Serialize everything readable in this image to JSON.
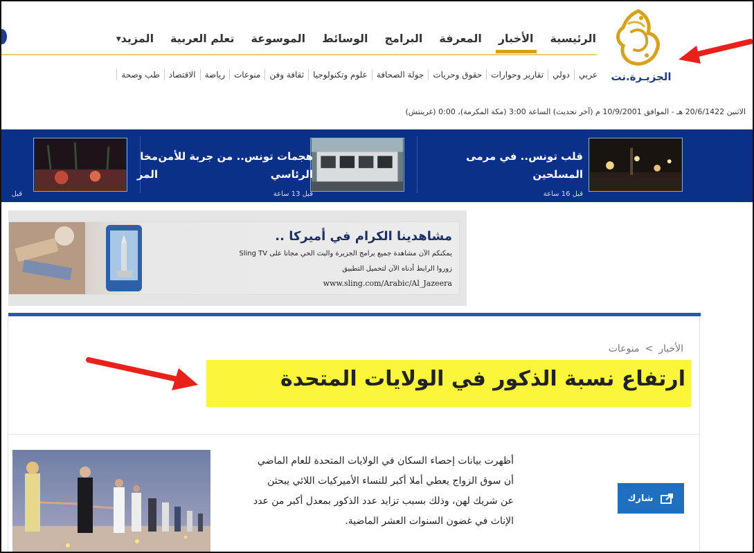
{
  "nav": {
    "main": [
      "الرئيسية",
      "الأخبار",
      "المعرفة",
      "البرامج",
      "الوسائط",
      "الموسوعة",
      "تعلم العربية",
      "المزيد"
    ],
    "active_index": 1,
    "sub": [
      "عربي",
      "دولي",
      "تقارير وحوارات",
      "حقوق وحريات",
      "جولة الصحافة",
      "علوم وتكنولوجيا",
      "ثقافة وفن",
      "منوعات",
      "رياضة",
      "الاقتصاد",
      "طب وصحة"
    ]
  },
  "brand": {
    "name": "الجزيـرة.نت",
    "accent": "#d7a21b",
    "blue": "#0a3088"
  },
  "dateline": "الاثنين 20/6/1422 هـ - الموافق 10/9/2001 م (آخر تحديث) الساعة 3:00 (مكة المكرمة)، 0:00 (غرينتش)",
  "ticker": [
    {
      "title_l1": "قلب تونس.. في مرمى",
      "title_l2": "المسلحين",
      "time": "قبل 16 ساعة"
    },
    {
      "title_l1": "هجمات تونس.. من جربة للأمن",
      "title_l2": "الرئاسي",
      "time": "قبل 13 ساعة"
    },
    {
      "title_l1": "مخا",
      "title_l2": "المر",
      "time": "قبل"
    }
  ],
  "ad": {
    "title": "مشاهدينا الكرام في أميركا ..",
    "line1": "يمكنكم الآن مشاهدة جميع برامج الجزيرة والبث الحي مجانا على Sling TV",
    "line2": "زوروا الرابط أدناه الآن لتحميل التطبيق",
    "url": "www.sling.com/Arabic/Al_Jazeera"
  },
  "breadcrumb": {
    "first": "الأخبار",
    "sep": ">",
    "second": "منوعات"
  },
  "article": {
    "headline": "ارتفاع نسبة الذكور في الولايات المتحدة",
    "body": [
      "أظهرت بيانات إحصاء السكان في الولايات المتحدة للعام الماضي",
      "أن سوق الزواج يعطي أملا أكبر للنساء الأميركيات اللائي يبحثن",
      "عن شريك لهن، وذلك بسبب تزايد عدد الذكور بمعدل أكبر من عدد",
      "الإناث في غضون السنوات العشر الماضية."
    ]
  },
  "share": {
    "label": "شارك",
    "icon": "share-icon"
  },
  "annotation": {
    "arrow_color": "#e8211b",
    "highlight_color": "#fbf63a"
  }
}
